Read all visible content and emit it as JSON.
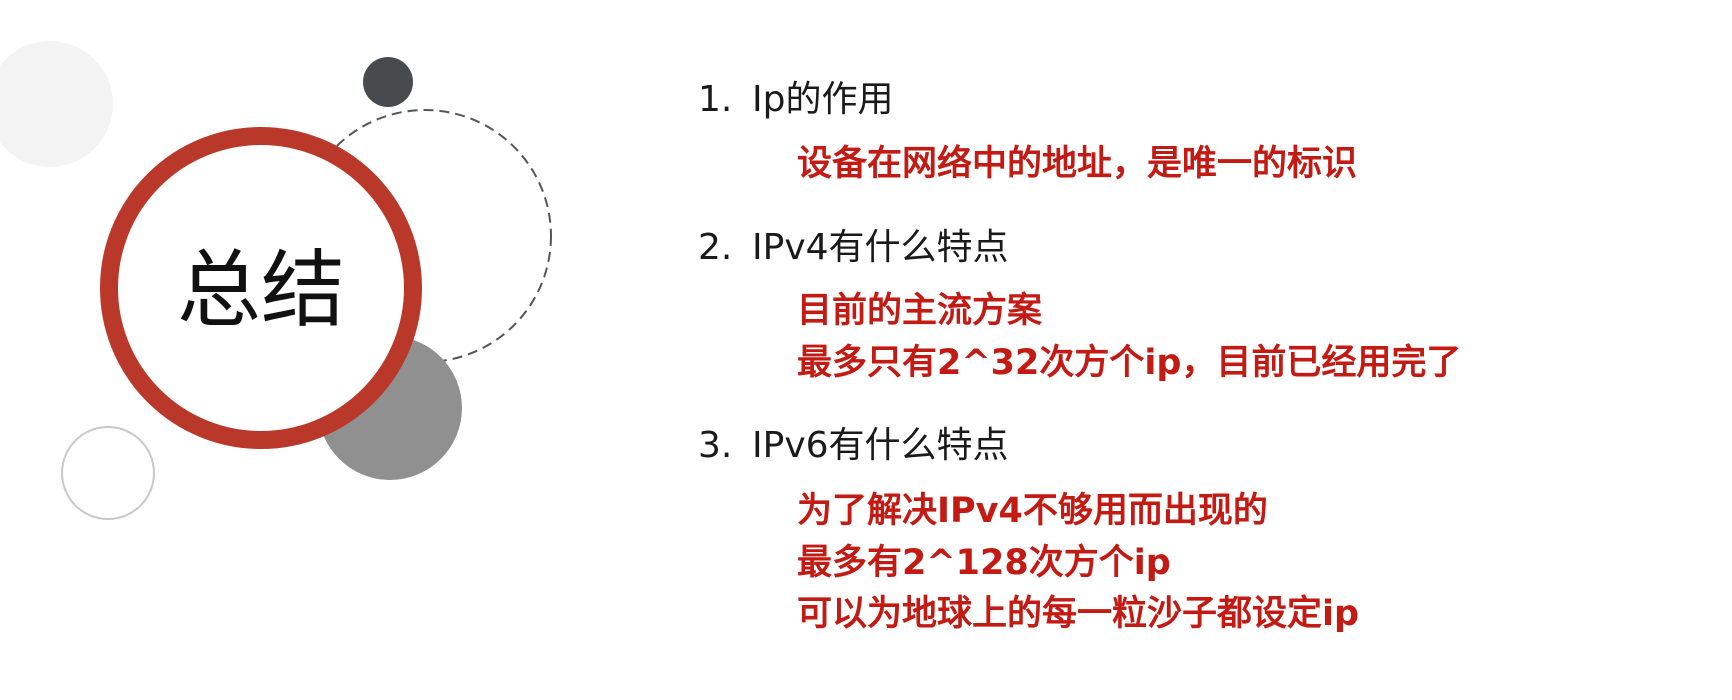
{
  "slide": {
    "title": "总结",
    "colors": {
      "accent_red": "#b9382a",
      "answer_red": "#c41a14",
      "dark_circle": "#474b4e",
      "gray_circle": "#909090",
      "light_circle": "#f3f3f3"
    },
    "items": [
      {
        "number": "1.",
        "question": "Ip的作用",
        "answers": [
          "设备在网络中的地址，是唯一的标识"
        ]
      },
      {
        "number": "2.",
        "question": "IPv4有什么特点",
        "answers": [
          "目前的主流方案",
          "最多只有2^32次方个ip，目前已经用完了"
        ]
      },
      {
        "number": "3.",
        "question": "IPv6有什么特点",
        "answers": [
          "为了解决IPv4不够用而出现的",
          "最多有2^128次方个ip",
          "可以为地球上的每一粒沙子都设定ip"
        ]
      }
    ]
  }
}
